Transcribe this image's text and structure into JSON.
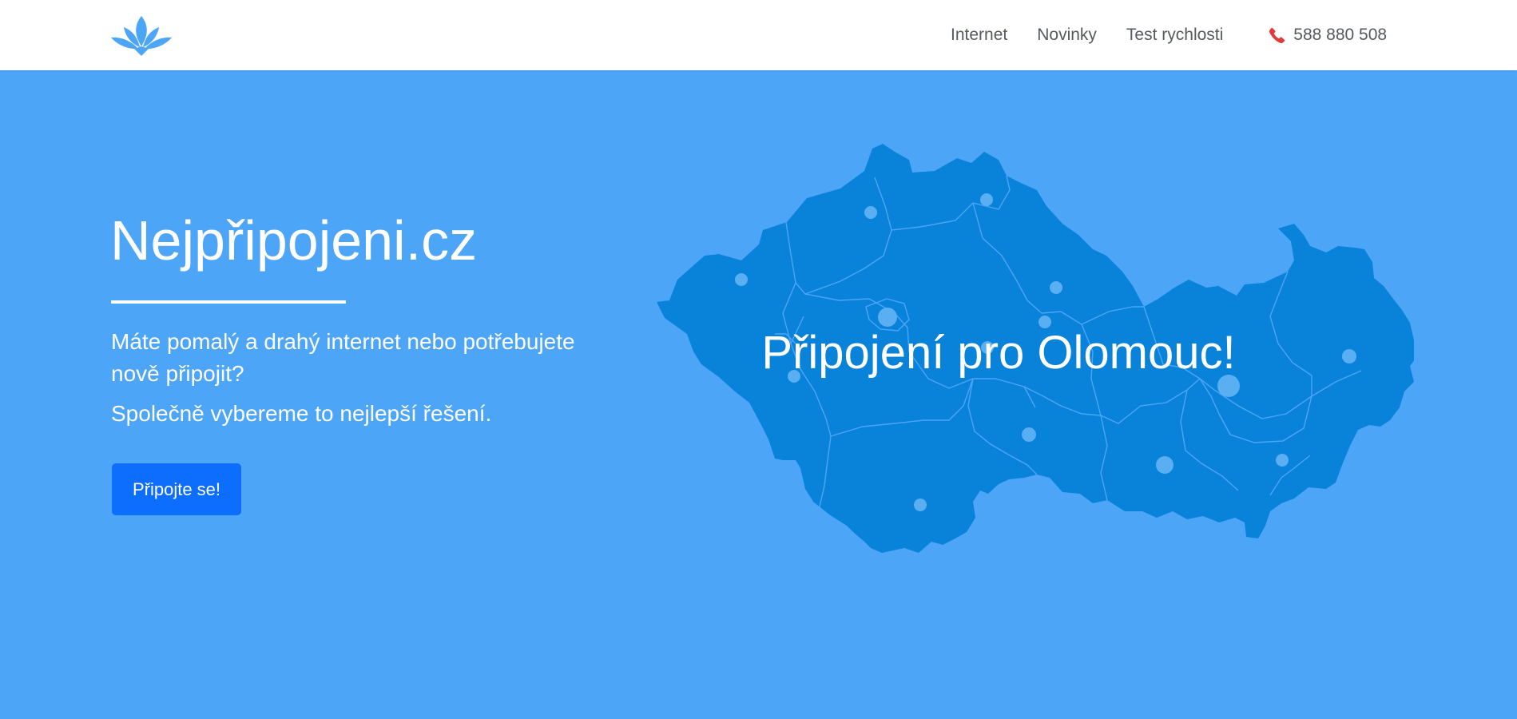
{
  "header": {
    "logo_icon": "lotus-icon",
    "nav": [
      {
        "label": "Internet"
      },
      {
        "label": "Novinky"
      },
      {
        "label": "Test rychlosti"
      }
    ],
    "phone": {
      "icon": "phone-icon",
      "number": "588 880 508"
    }
  },
  "hero": {
    "title": "Nejpřipojeni.cz",
    "text1": "Máte pomalý a drahý internet nebo potřebujete nově připojit?",
    "text2": "Společně vybereme to nejlepší řešení.",
    "cta_label": "Připojte se!",
    "map_caption": "Připojení pro Olomouc!"
  },
  "colors": {
    "hero_bg": "#4da5f8",
    "map_fill": "#0982d9",
    "map_lines": "#4da5f8",
    "city_dot": "#5aaef2",
    "cta_bg": "#0d6efd",
    "phone_icon": "#e03a3a",
    "nav_text": "#555a5f"
  }
}
